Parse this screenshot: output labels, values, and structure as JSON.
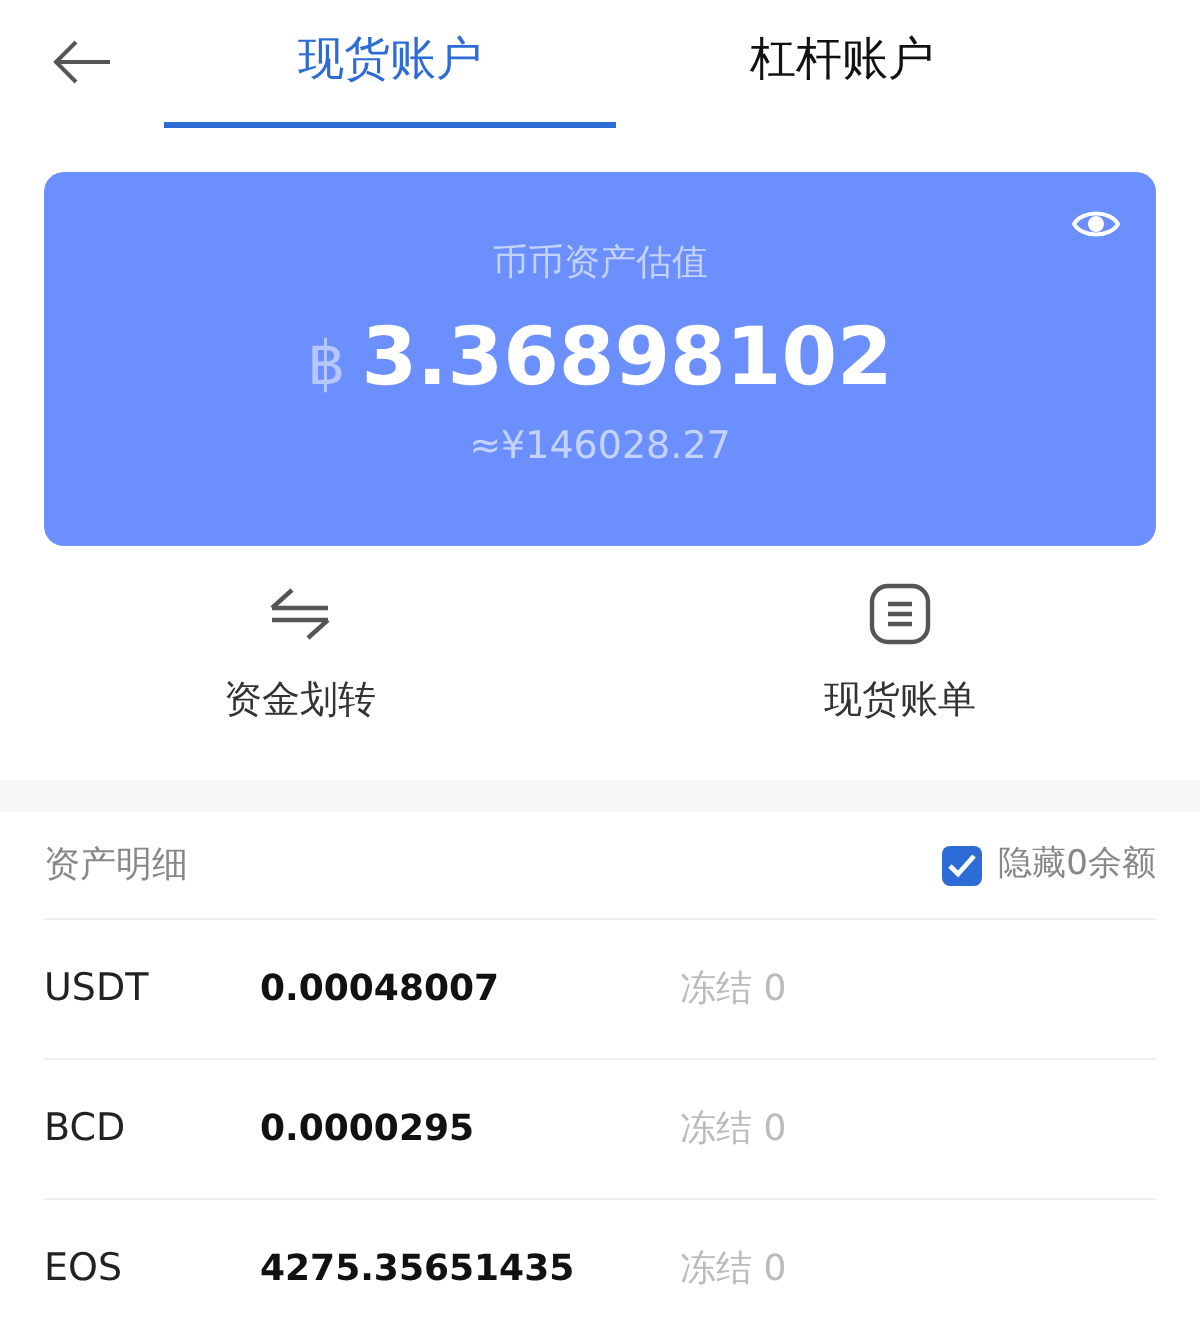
{
  "tabs": [
    {
      "label": "现货账户",
      "selected": true
    },
    {
      "label": "杠杆账户",
      "selected": false
    }
  ],
  "balance_card": {
    "title": "币币资产估值",
    "currency_symbol": "฿",
    "amount": "3.36898102",
    "fiat": "≈¥146028.27"
  },
  "actions": [
    {
      "kind": "transfer",
      "label": "资金划转"
    },
    {
      "kind": "bill",
      "label": "现货账单"
    }
  ],
  "assets": {
    "title": "资产明细",
    "hide_zero": {
      "label": "隐藏0余额",
      "checked": true
    },
    "rows": [
      {
        "coin": "USDT",
        "amount": "0.00048007",
        "frozen": "冻结 0"
      },
      {
        "coin": "BCD",
        "amount": "0.0000295",
        "frozen": "冻结 0"
      },
      {
        "coin": "EOS",
        "amount": "4275.35651435",
        "frozen": "冻结 0"
      }
    ]
  }
}
